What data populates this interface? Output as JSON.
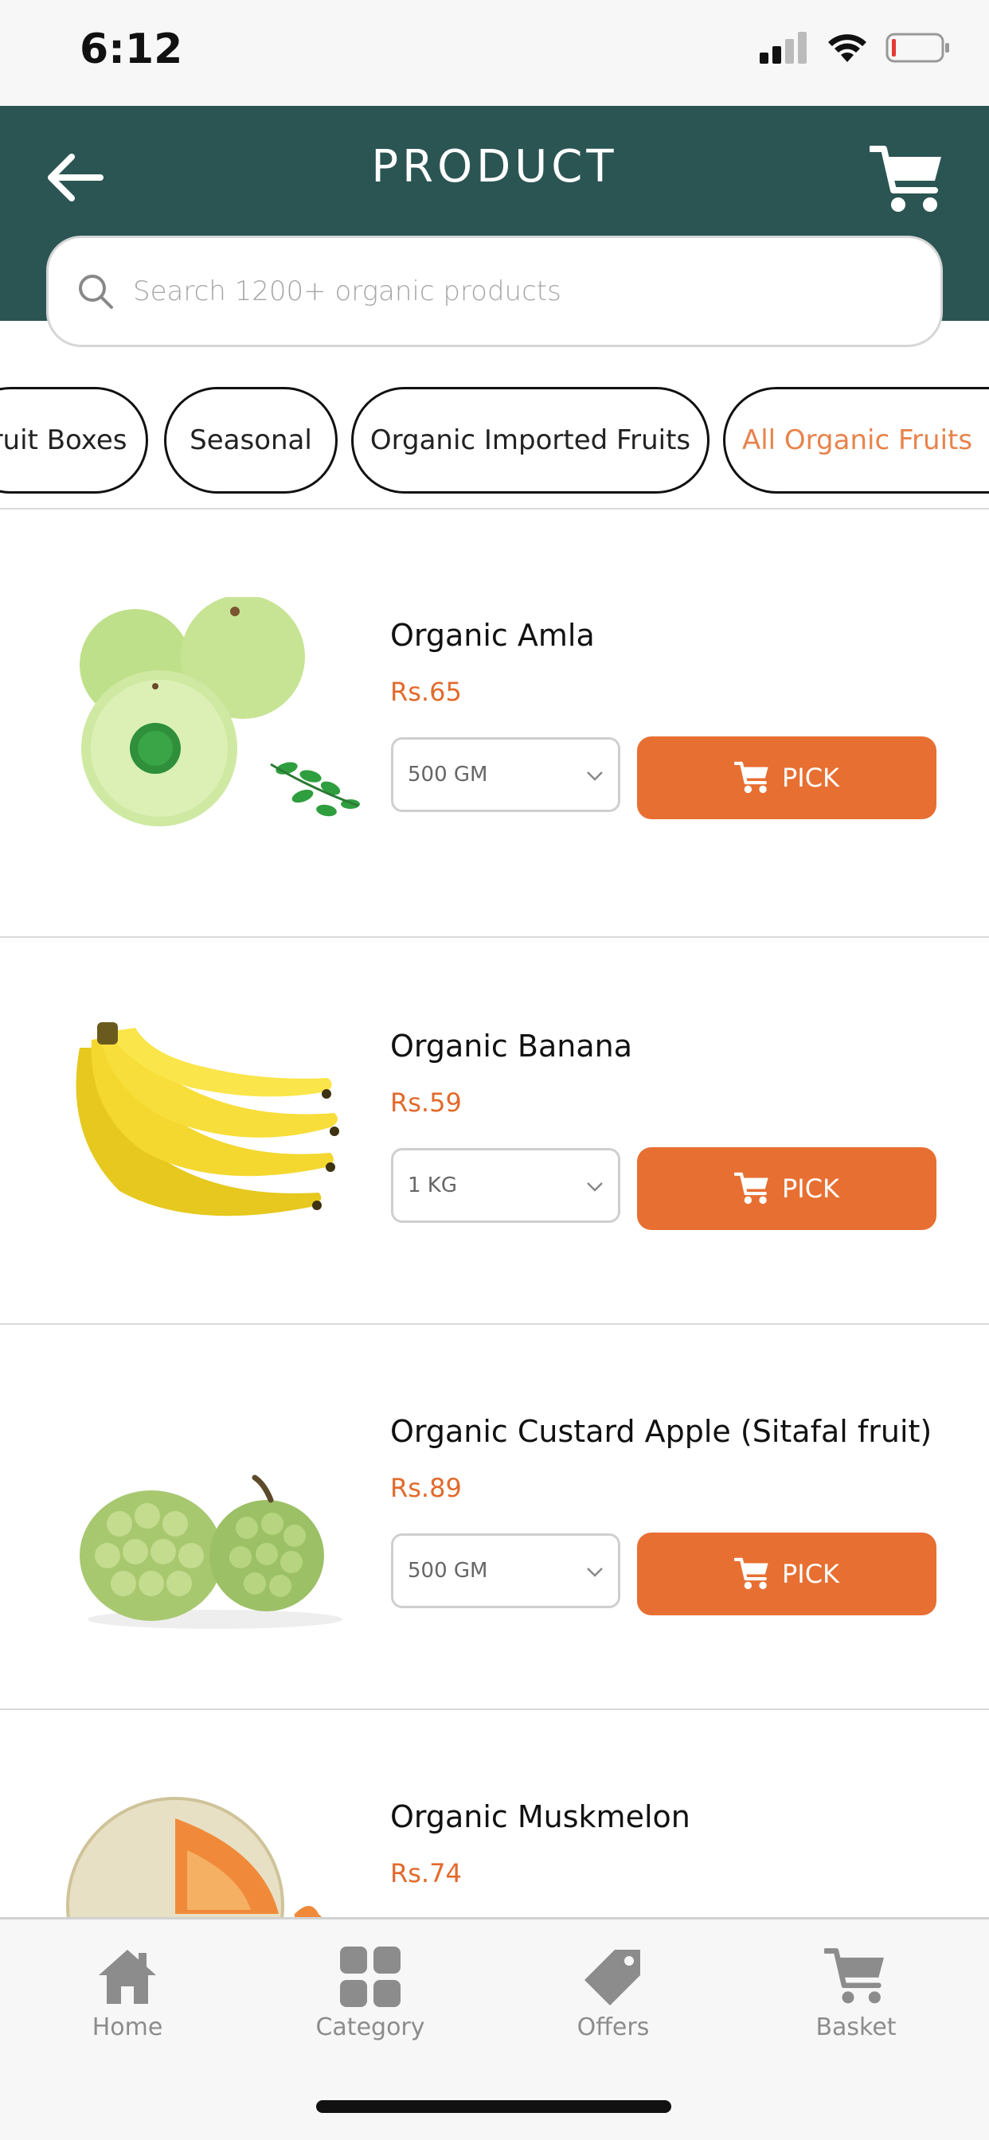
{
  "status_bar": {
    "time": "6:12"
  },
  "header": {
    "title": "PRODUCT"
  },
  "search": {
    "placeholder": "Search 1200+ organic products"
  },
  "categories": [
    {
      "label": "Fruit Boxes",
      "active": false
    },
    {
      "label": "Seasonal",
      "active": false
    },
    {
      "label": "Organic Imported Fruits",
      "active": false
    },
    {
      "label": "All Organic Fruits",
      "active": true
    }
  ],
  "products": [
    {
      "name": "Organic Amla",
      "price": "Rs.65",
      "size": "500 GM",
      "button": "PICK"
    },
    {
      "name": "Organic Banana",
      "price": "Rs.59",
      "size": "1 KG",
      "button": "PICK"
    },
    {
      "name": "Organic Custard Apple (Sitafal fruit)",
      "price": "Rs.89",
      "size": "500 GM",
      "button": "PICK"
    },
    {
      "name": "Organic Muskmelon",
      "price": "Rs.74"
    }
  ],
  "bottom_nav": [
    {
      "label": "Home",
      "icon": "home-icon"
    },
    {
      "label": "Category",
      "icon": "grid-icon"
    },
    {
      "label": "Offers",
      "icon": "tag-icon"
    },
    {
      "label": "Basket",
      "icon": "cart-icon"
    }
  ],
  "colors": {
    "header": "#2b5553",
    "accent": "#e76f32",
    "price": "#e26a2c",
    "active_chip": "#e8834c"
  }
}
